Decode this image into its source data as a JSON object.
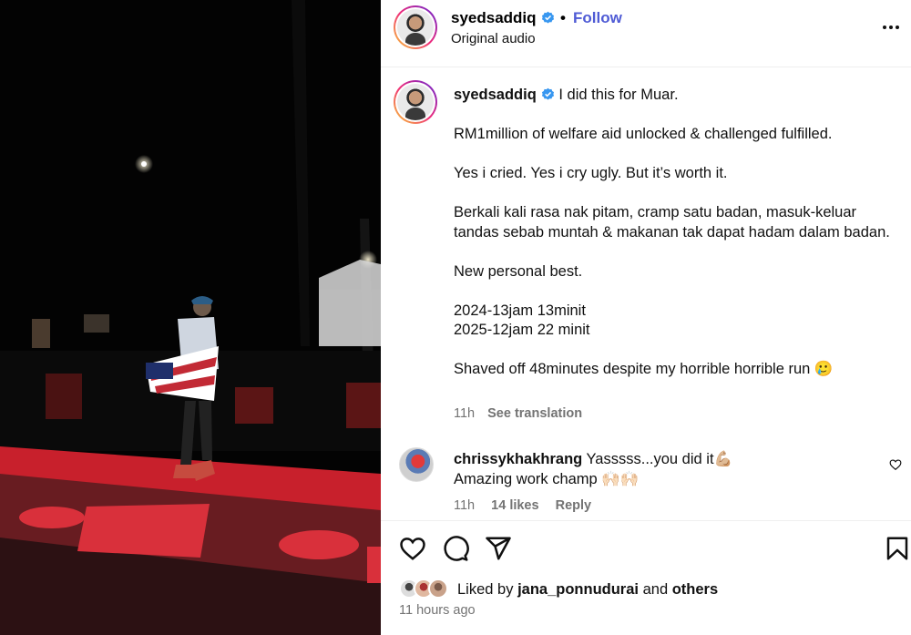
{
  "post": {
    "username": "syedsaddiq",
    "separator": "•",
    "follow_label": "Follow",
    "audio_label": "Original audio",
    "more_icon": "more-horizontal-icon"
  },
  "caption": {
    "username": "syedsaddiq",
    "line1": "I did this for Muar.",
    "para2": "RM1million of welfare aid unlocked & challenged fulfilled.",
    "para3": "Yes i cried. Yes i cry ugly. But it’s worth it.",
    "para4": "Berkali kali rasa nak pitam, cramp satu badan, masuk-keluar tandas sebab muntah & makanan tak dapat hadam dalam badan.",
    "para5": "New personal best.",
    "para6a": "2024-13jam 13minit",
    "para6b": "2025-12jam 22 minit",
    "para7": "Shaved off 48minutes despite my horrible horrible run 🥲",
    "time": "11h",
    "translate_label": "See translation"
  },
  "comment": {
    "username": "chrissykhakhrang",
    "text_line1": "Yasssss...you did it💪🏼",
    "text_line2": "Amazing work champ 🙌🏻🙌🏻",
    "time": "11h",
    "likes": "14 likes",
    "reply_label": "Reply"
  },
  "actions": {
    "like_icon": "heart-icon",
    "comment_icon": "comment-icon",
    "share_icon": "share-icon",
    "save_icon": "bookmark-icon"
  },
  "likes": {
    "prefix": "Liked by",
    "user": "jana_ponnudurai",
    "and": "and",
    "others": "others"
  },
  "timestamp": "11 hours ago",
  "colors": {
    "accent": "#4f5bd5",
    "verified": "#3897f0",
    "muted": "#737373",
    "track_red": "#d9303b"
  }
}
